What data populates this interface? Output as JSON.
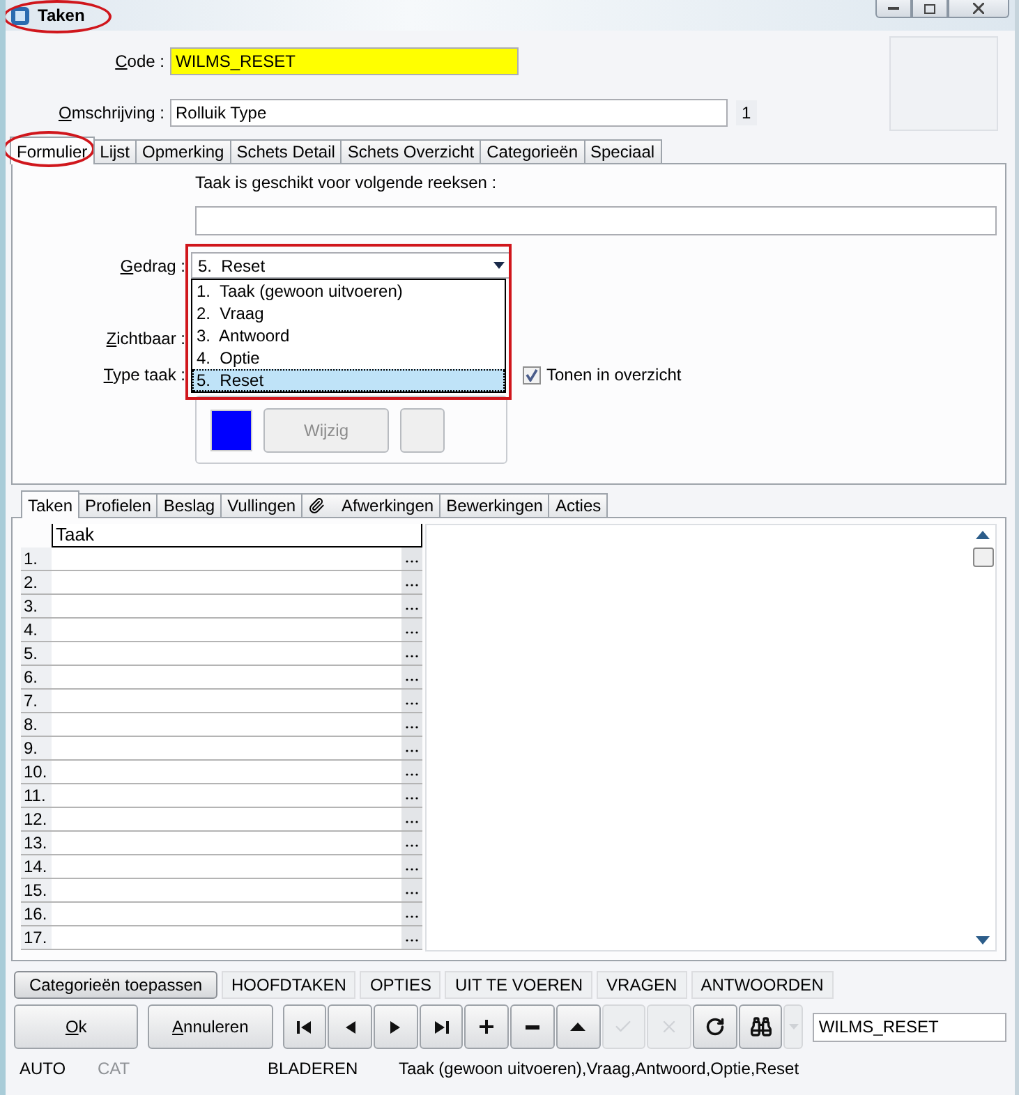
{
  "window": {
    "title": "Taken"
  },
  "header": {
    "code_label": "Code :",
    "code_value": "WILMS_RESET",
    "description_label": "Omschrijving :",
    "description_value": "Rolluik Type",
    "counter": "1"
  },
  "tabs": [
    {
      "label": "Formulier",
      "selected": true
    },
    {
      "label": "Lijst",
      "selected": false
    },
    {
      "label": "Opmerking",
      "selected": false
    },
    {
      "label": "Schets Detail",
      "selected": false
    },
    {
      "label": "Schets Overzicht",
      "selected": false
    },
    {
      "label": "Categorieën",
      "selected": false
    },
    {
      "label": "Speciaal",
      "selected": false
    }
  ],
  "form": {
    "series_label": "Taak is geschikt voor volgende reeksen :",
    "behaviour": {
      "label": "Gedrag :",
      "value": "5.  Reset",
      "expanded": true,
      "options": [
        {
          "label": "1.  Taak (gewoon uitvoeren)",
          "selected": false
        },
        {
          "label": "2.  Vraag",
          "selected": false
        },
        {
          "label": "3.  Antwoord",
          "selected": false
        },
        {
          "label": "4.  Optie",
          "selected": false
        },
        {
          "label": "5.  Reset",
          "selected": true
        }
      ]
    },
    "visible_label": "Zichtbaar :",
    "type_label": "Type taak :",
    "show_in_overview": {
      "label": "Tonen in overzicht",
      "checked": true
    },
    "edit_button": {
      "label": "Wijzig",
      "disabled": true
    }
  },
  "detail_tabs": [
    {
      "label": "Taken",
      "selected": true,
      "kind": "plain"
    },
    {
      "label": "Profielen",
      "selected": false,
      "kind": "plain"
    },
    {
      "label": "Beslag",
      "selected": false,
      "kind": "plain"
    },
    {
      "label": "Vullingen",
      "selected": false,
      "kind": "plain"
    },
    {
      "label": "Afwerkingen",
      "selected": false,
      "kind": "attachment"
    },
    {
      "label": "Bewerkingen",
      "selected": false,
      "kind": "plain"
    },
    {
      "label": "Acties",
      "selected": false,
      "kind": "plain"
    }
  ],
  "grid": {
    "columns": [
      "Taak"
    ],
    "rows": [
      "1.",
      "2.",
      "3.",
      "4.",
      "5.",
      "6.",
      "7.",
      "8.",
      "9.",
      "10.",
      "11.",
      "12.",
      "13.",
      "14.",
      "15.",
      "16.",
      "17."
    ]
  },
  "filter_buttons": [
    {
      "label": "Categorieën toepassen",
      "kind": "raised"
    },
    {
      "label": "HOOFDTAKEN",
      "kind": "flat"
    },
    {
      "label": "OPTIES",
      "kind": "flat"
    },
    {
      "label": "UIT TE VOEREN",
      "kind": "flat"
    },
    {
      "label": "VRAGEN",
      "kind": "flat"
    },
    {
      "label": "ANTWOORDEN",
      "kind": "flat"
    }
  ],
  "actions": {
    "ok": "Ok",
    "cancel": "Annuleren"
  },
  "navigator": [
    {
      "kind": "first",
      "disabled": false
    },
    {
      "kind": "prev",
      "disabled": false
    },
    {
      "kind": "next",
      "disabled": false
    },
    {
      "kind": "last",
      "disabled": false
    },
    {
      "kind": "add",
      "disabled": false
    },
    {
      "kind": "remove",
      "disabled": false
    },
    {
      "kind": "up",
      "disabled": false
    },
    {
      "kind": "confirm",
      "disabled": true
    },
    {
      "kind": "cancel",
      "disabled": true
    },
    {
      "kind": "refresh",
      "disabled": false
    },
    {
      "kind": "find",
      "disabled": false
    },
    {
      "kind": "more",
      "disabled": true
    }
  ],
  "search_value": "WILMS_RESET",
  "status_bar": [
    {
      "text": "AUTO",
      "disabled": false
    },
    {
      "text": "CAT",
      "disabled": true
    },
    {
      "text": "BLADEREN",
      "disabled": false
    },
    {
      "text": "Taak (gewoon uitvoeren),Vraag,Antwoord,Optie,Reset",
      "disabled": false
    }
  ]
}
